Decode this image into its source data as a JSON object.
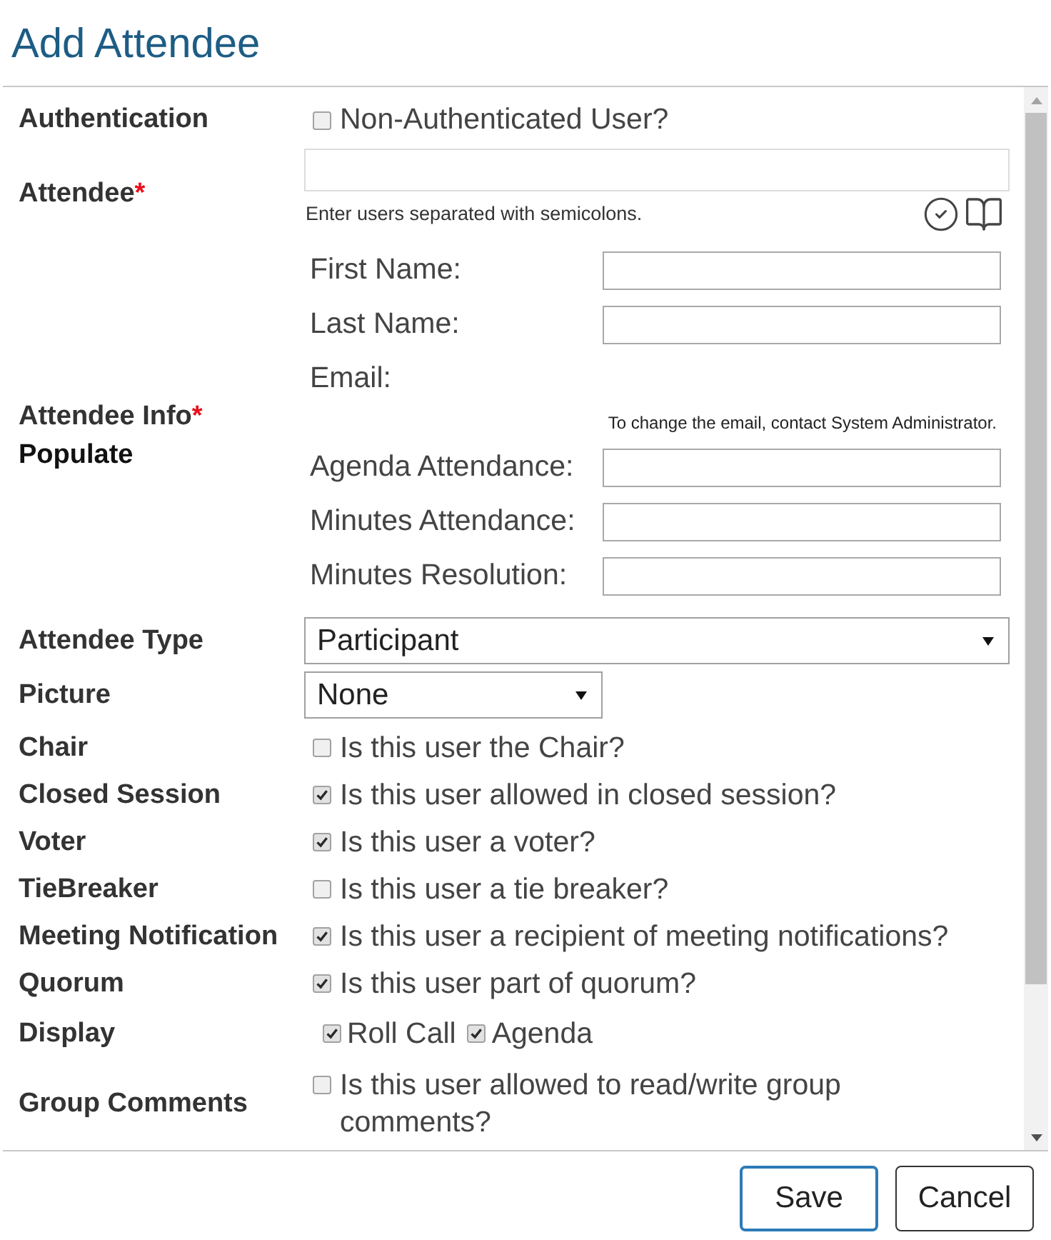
{
  "dialog": {
    "title": "Add Attendee"
  },
  "authentication": {
    "label": "Authentication",
    "kind": "single",
    "choices": [
      {
        "label": "Non-Authenticated User?",
        "checked": false
      }
    ]
  },
  "attendee": {
    "label": "Attendee",
    "required_mark": "*",
    "hint": "Enter users separated with semicolons."
  },
  "attendee_info": {
    "label": "Attendee Info",
    "required_mark": "*",
    "sublabel": "Populate",
    "fields": [
      {
        "kind": "input",
        "label": "First Name:"
      },
      {
        "kind": "input",
        "label": "Last Name:"
      },
      {
        "kind": "readonly",
        "label": "Email:",
        "note": "To change the email, contact System Administrator."
      },
      {
        "kind": "input",
        "label": "Agenda Attendance:"
      },
      {
        "kind": "input",
        "label": "Minutes Attendance:"
      },
      {
        "kind": "input",
        "label": "Minutes Resolution:"
      }
    ]
  },
  "attendee_type": {
    "label": "Attendee Type",
    "value": "Participant"
  },
  "picture": {
    "label": "Picture",
    "value": "None"
  },
  "options": [
    {
      "label": "Chair",
      "kind": "single",
      "choices": [
        {
          "label": "Is this user the Chair?",
          "checked": false
        }
      ]
    },
    {
      "label": "Closed Session",
      "kind": "single",
      "choices": [
        {
          "label": "Is this user allowed in closed session?",
          "checked": true
        }
      ]
    },
    {
      "label": "Voter",
      "kind": "single",
      "choices": [
        {
          "label": "Is this user a voter?",
          "checked": true
        }
      ]
    },
    {
      "label": "TieBreaker",
      "kind": "single",
      "choices": [
        {
          "label": "Is this user a tie breaker?",
          "checked": false
        }
      ]
    },
    {
      "label": "Meeting Notification",
      "kind": "single",
      "choices": [
        {
          "label": "Is this user a recipient of meeting notifications?",
          "checked": true
        }
      ]
    },
    {
      "label": "Quorum",
      "kind": "single",
      "choices": [
        {
          "label": "Is this user part of quorum?",
          "checked": true
        }
      ]
    },
    {
      "label": "Display",
      "kind": "inline",
      "choices": [
        {
          "label": "Roll Call",
          "checked": true
        },
        {
          "label": "Agenda",
          "checked": true
        }
      ]
    },
    {
      "label": "Group Comments",
      "kind": "wrap",
      "choices": [
        {
          "label": "Is this user allowed to read/write group comments?",
          "checked": false
        }
      ]
    }
  ],
  "buttons": [
    {
      "label": "Save",
      "focused": true
    },
    {
      "label": "Cancel",
      "focused": false
    }
  ]
}
